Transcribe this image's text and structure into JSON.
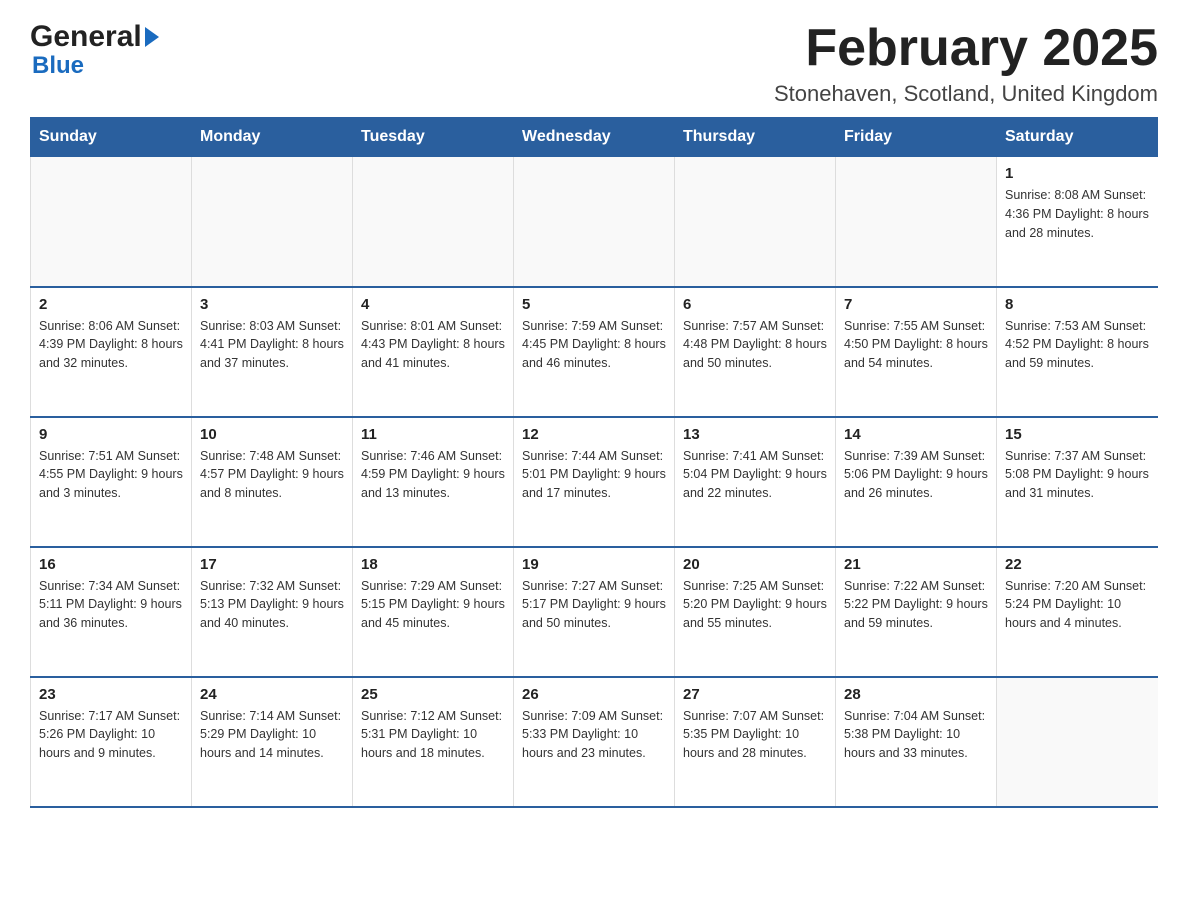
{
  "logo": {
    "line1": "General",
    "line2": "Blue"
  },
  "header": {
    "month": "February 2025",
    "location": "Stonehaven, Scotland, United Kingdom"
  },
  "days_of_week": [
    "Sunday",
    "Monday",
    "Tuesday",
    "Wednesday",
    "Thursday",
    "Friday",
    "Saturday"
  ],
  "weeks": [
    [
      {
        "day": "",
        "info": ""
      },
      {
        "day": "",
        "info": ""
      },
      {
        "day": "",
        "info": ""
      },
      {
        "day": "",
        "info": ""
      },
      {
        "day": "",
        "info": ""
      },
      {
        "day": "",
        "info": ""
      },
      {
        "day": "1",
        "info": "Sunrise: 8:08 AM\nSunset: 4:36 PM\nDaylight: 8 hours and 28 minutes."
      }
    ],
    [
      {
        "day": "2",
        "info": "Sunrise: 8:06 AM\nSunset: 4:39 PM\nDaylight: 8 hours and 32 minutes."
      },
      {
        "day": "3",
        "info": "Sunrise: 8:03 AM\nSunset: 4:41 PM\nDaylight: 8 hours and 37 minutes."
      },
      {
        "day": "4",
        "info": "Sunrise: 8:01 AM\nSunset: 4:43 PM\nDaylight: 8 hours and 41 minutes."
      },
      {
        "day": "5",
        "info": "Sunrise: 7:59 AM\nSunset: 4:45 PM\nDaylight: 8 hours and 46 minutes."
      },
      {
        "day": "6",
        "info": "Sunrise: 7:57 AM\nSunset: 4:48 PM\nDaylight: 8 hours and 50 minutes."
      },
      {
        "day": "7",
        "info": "Sunrise: 7:55 AM\nSunset: 4:50 PM\nDaylight: 8 hours and 54 minutes."
      },
      {
        "day": "8",
        "info": "Sunrise: 7:53 AM\nSunset: 4:52 PM\nDaylight: 8 hours and 59 minutes."
      }
    ],
    [
      {
        "day": "9",
        "info": "Sunrise: 7:51 AM\nSunset: 4:55 PM\nDaylight: 9 hours and 3 minutes."
      },
      {
        "day": "10",
        "info": "Sunrise: 7:48 AM\nSunset: 4:57 PM\nDaylight: 9 hours and 8 minutes."
      },
      {
        "day": "11",
        "info": "Sunrise: 7:46 AM\nSunset: 4:59 PM\nDaylight: 9 hours and 13 minutes."
      },
      {
        "day": "12",
        "info": "Sunrise: 7:44 AM\nSunset: 5:01 PM\nDaylight: 9 hours and 17 minutes."
      },
      {
        "day": "13",
        "info": "Sunrise: 7:41 AM\nSunset: 5:04 PM\nDaylight: 9 hours and 22 minutes."
      },
      {
        "day": "14",
        "info": "Sunrise: 7:39 AM\nSunset: 5:06 PM\nDaylight: 9 hours and 26 minutes."
      },
      {
        "day": "15",
        "info": "Sunrise: 7:37 AM\nSunset: 5:08 PM\nDaylight: 9 hours and 31 minutes."
      }
    ],
    [
      {
        "day": "16",
        "info": "Sunrise: 7:34 AM\nSunset: 5:11 PM\nDaylight: 9 hours and 36 minutes."
      },
      {
        "day": "17",
        "info": "Sunrise: 7:32 AM\nSunset: 5:13 PM\nDaylight: 9 hours and 40 minutes."
      },
      {
        "day": "18",
        "info": "Sunrise: 7:29 AM\nSunset: 5:15 PM\nDaylight: 9 hours and 45 minutes."
      },
      {
        "day": "19",
        "info": "Sunrise: 7:27 AM\nSunset: 5:17 PM\nDaylight: 9 hours and 50 minutes."
      },
      {
        "day": "20",
        "info": "Sunrise: 7:25 AM\nSunset: 5:20 PM\nDaylight: 9 hours and 55 minutes."
      },
      {
        "day": "21",
        "info": "Sunrise: 7:22 AM\nSunset: 5:22 PM\nDaylight: 9 hours and 59 minutes."
      },
      {
        "day": "22",
        "info": "Sunrise: 7:20 AM\nSunset: 5:24 PM\nDaylight: 10 hours and 4 minutes."
      }
    ],
    [
      {
        "day": "23",
        "info": "Sunrise: 7:17 AM\nSunset: 5:26 PM\nDaylight: 10 hours and 9 minutes."
      },
      {
        "day": "24",
        "info": "Sunrise: 7:14 AM\nSunset: 5:29 PM\nDaylight: 10 hours and 14 minutes."
      },
      {
        "day": "25",
        "info": "Sunrise: 7:12 AM\nSunset: 5:31 PM\nDaylight: 10 hours and 18 minutes."
      },
      {
        "day": "26",
        "info": "Sunrise: 7:09 AM\nSunset: 5:33 PM\nDaylight: 10 hours and 23 minutes."
      },
      {
        "day": "27",
        "info": "Sunrise: 7:07 AM\nSunset: 5:35 PM\nDaylight: 10 hours and 28 minutes."
      },
      {
        "day": "28",
        "info": "Sunrise: 7:04 AM\nSunset: 5:38 PM\nDaylight: 10 hours and 33 minutes."
      },
      {
        "day": "",
        "info": ""
      }
    ]
  ]
}
